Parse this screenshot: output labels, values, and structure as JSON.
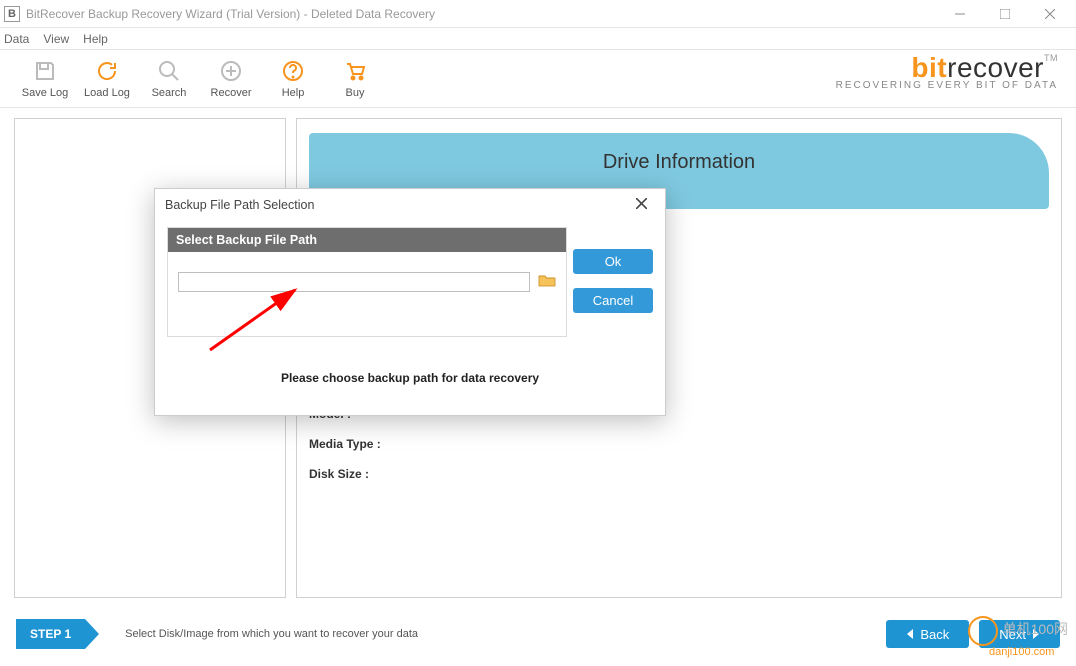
{
  "window": {
    "title": "BitRecover Backup Recovery Wizard (Trial Version) - Deleted Data Recovery"
  },
  "menu": {
    "data": "Data",
    "view": "View",
    "help": "Help"
  },
  "toolbar": {
    "save_log": "Save Log",
    "load_log": "Load Log",
    "search": "Search",
    "recover": "Recover",
    "help": "Help",
    "buy": "Buy"
  },
  "brand": {
    "bit": "bit",
    "recover": "recover",
    "tm": "TM",
    "tagline": "RECOVERING EVERY BIT OF DATA"
  },
  "panel": {
    "heading": "Drive Information",
    "model_label": "Model :",
    "media_label": "Media Type :",
    "size_label": "Disk Size :"
  },
  "footer": {
    "step": "STEP 1",
    "hint": "Select Disk/Image from which you want to recover your data",
    "back": "Back",
    "next": "Next"
  },
  "dialog": {
    "title": "Backup File Path Selection",
    "bar": "Select Backup File Path",
    "input_value": "",
    "ok": "Ok",
    "cancel": "Cancel",
    "message": "Please choose backup path for data recovery"
  },
  "watermark": {
    "cn": "单机100网",
    "url": "danji100.com"
  }
}
